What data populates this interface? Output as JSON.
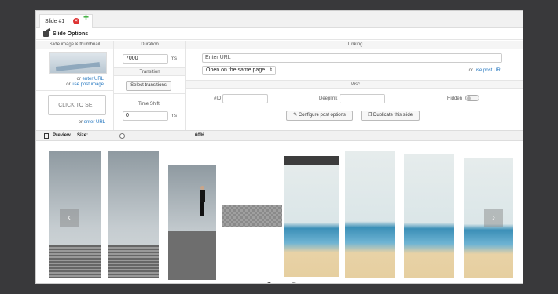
{
  "tabs": {
    "slide_label": "Slide #1",
    "close_icon": "close-icon",
    "add_icon": "plus-icon"
  },
  "slide_options": {
    "title": "Slide Options",
    "icon": "settings-icon"
  },
  "columns": {
    "image_thumbnail": "Slide image & thumbnail",
    "duration": "Duration",
    "linking": "Linking",
    "transition": "Transition",
    "misc": "Misc"
  },
  "image": {
    "or_1": "or",
    "enter_url": "enter URL",
    "or_2": "or",
    "use_post_image": "use post image",
    "click_to_set": "CLICK TO SET",
    "or_3": "or",
    "enter_url_2": "enter URL"
  },
  "duration": {
    "value": "7000",
    "unit": "ms"
  },
  "transition": {
    "select_button": "Select transitions"
  },
  "time_shift": {
    "label": "Time Shift",
    "value": "0",
    "unit": "ms"
  },
  "linking": {
    "url_placeholder": "Enter URL",
    "open_option": "Open on the same page",
    "or": "or",
    "use_post_url": "use post URL"
  },
  "misc": {
    "id_label": "#ID",
    "deeplink_label": "Deeplink",
    "hidden_label": "Hidden",
    "configure_button": "Configure post options",
    "duplicate_button": "Duplicate this slide"
  },
  "preview": {
    "label": "Preview",
    "size_label": "Size:",
    "size_value": "60%",
    "size_fraction": 0.6
  },
  "colors": {
    "link": "#1e73be",
    "close": "#dd3333",
    "add": "#33aa33",
    "background": "#39393b"
  }
}
